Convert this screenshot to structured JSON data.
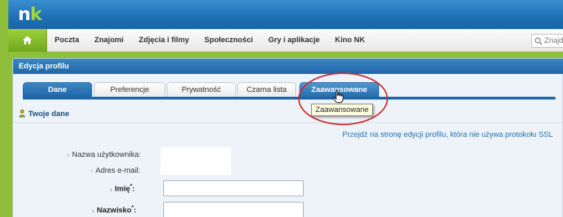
{
  "header": {
    "logo_n": "n",
    "logo_k": "k"
  },
  "nav": {
    "home_icon": "home-icon",
    "items": [
      {
        "label": "Poczta"
      },
      {
        "label": "Znajomi"
      },
      {
        "label": "Zdjęcia i filmy"
      },
      {
        "label": "Społeczności"
      },
      {
        "label": "Gry i aplikacje"
      },
      {
        "label": "Kino NK"
      }
    ],
    "search": {
      "placeholder": "Znajdź"
    }
  },
  "panel": {
    "title": "Edycja profilu",
    "tabs": [
      {
        "label": "Dane",
        "state": "active"
      },
      {
        "label": "Preferencje",
        "state": "normal"
      },
      {
        "label": "Prywatność",
        "state": "normal"
      },
      {
        "label": "Czarna lista",
        "state": "normal"
      },
      {
        "label": "Zaawansowane",
        "state": "hover"
      }
    ],
    "tooltip": "Zaawansowane",
    "section_title": "Twoje dane",
    "ssl_link": "Przejdź na stronę edycji profilu, która nie używa protokołu SSL",
    "fields": {
      "username_label": "Nazwa użytkownika:",
      "email_label": "Adres e-mail:",
      "first_name_label": "Imię",
      "last_name_label": "Nazwisko",
      "required_mark": "*",
      "colon": ":",
      "first_name_value": "",
      "last_name_value": ""
    }
  },
  "colors": {
    "brand_blue": "#1f6fb5",
    "brand_green": "#8fbf3a",
    "annotation_red": "#d22a2a"
  }
}
